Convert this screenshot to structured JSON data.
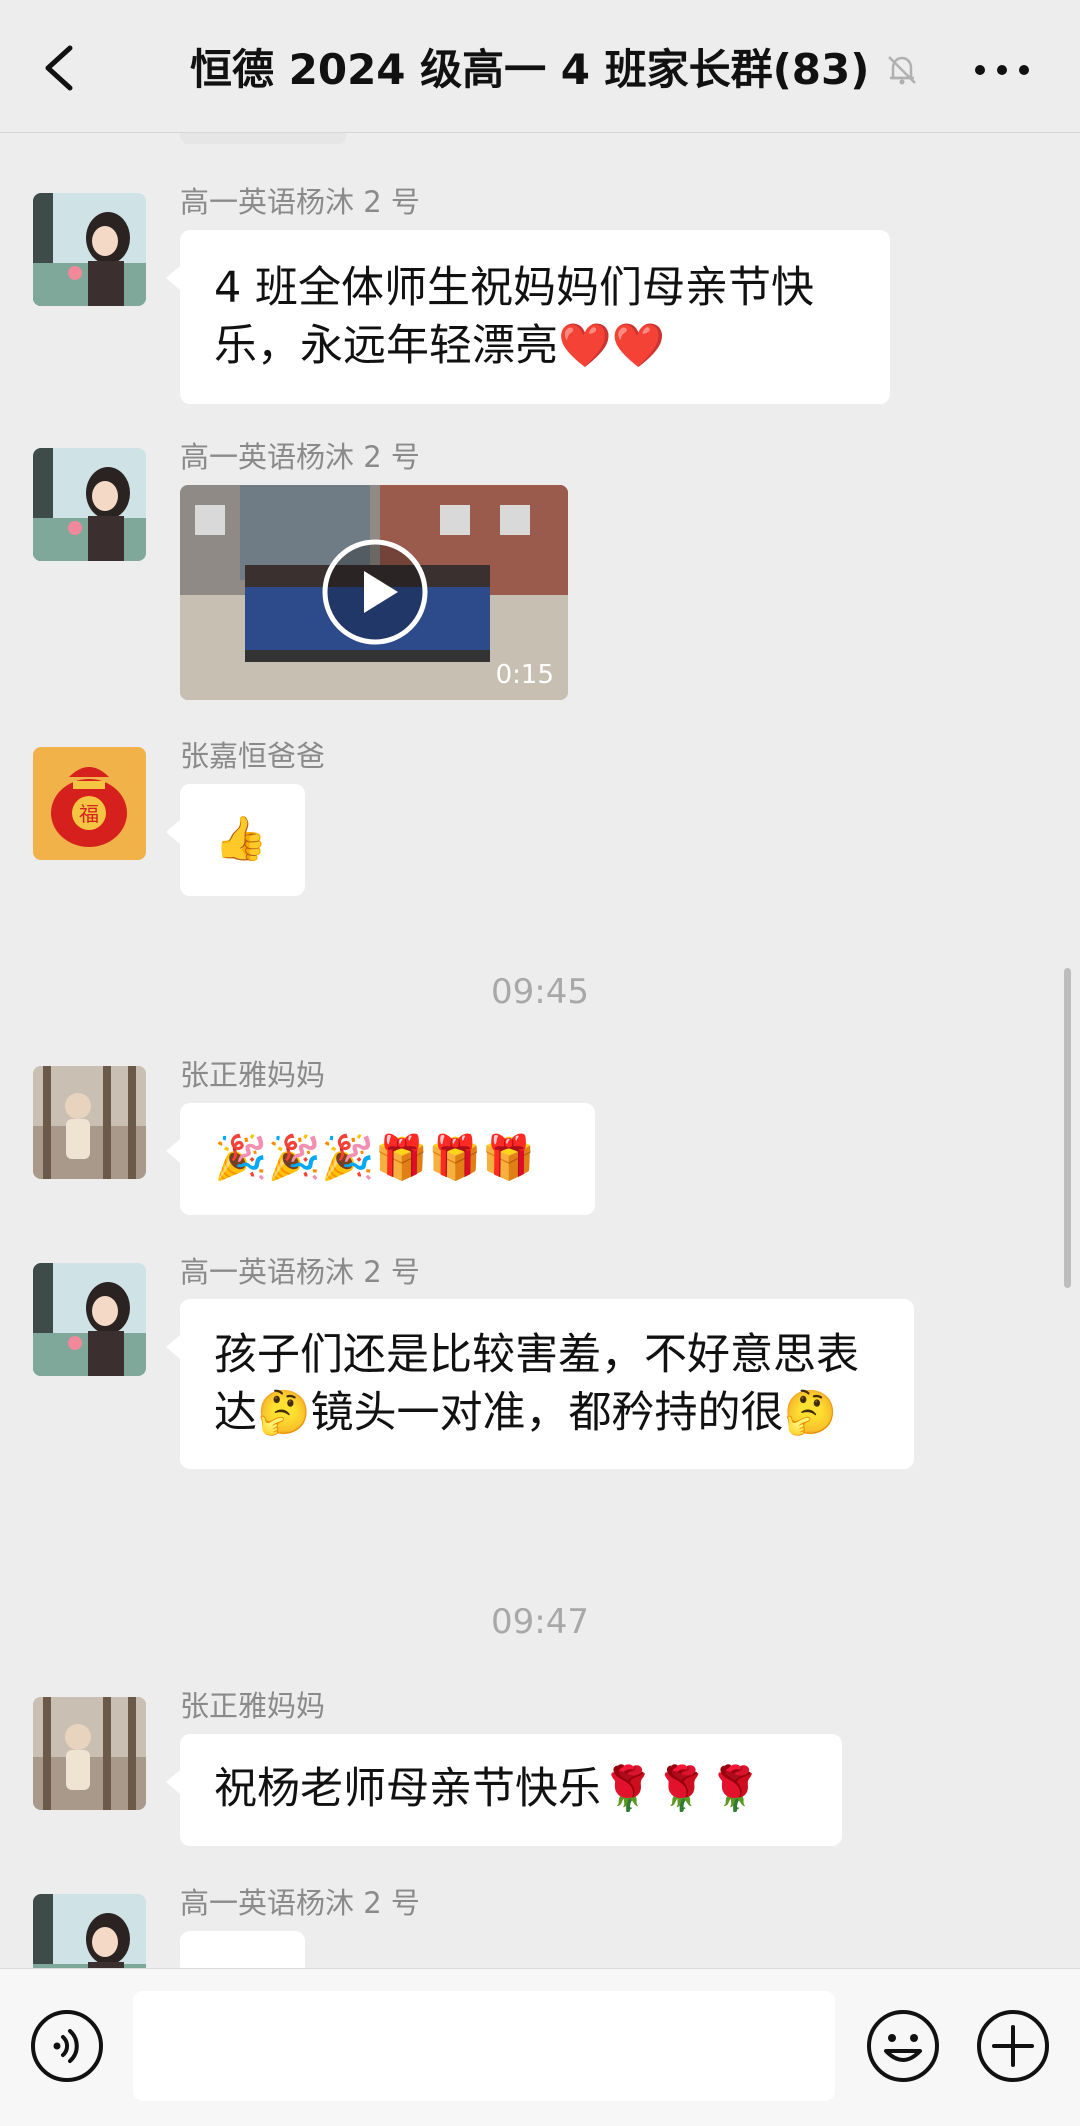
{
  "header": {
    "title": "恒德 2024 级高一 4 班家长群(83)",
    "back_icon": "chevron-left-icon",
    "mute_icon": "bell-slash-icon",
    "more_icon": "more-dots-icon"
  },
  "messages": [
    {
      "sender": "高一英语杨沐 2 号",
      "text": "4 班全体师生祝妈妈们母亲节快乐，永远年轻漂亮❤️❤️"
    },
    {
      "sender": "高一英语杨沐 2 号",
      "video_duration": "0:15"
    },
    {
      "sender": "张嘉恒爸爸",
      "text": "👍"
    },
    {
      "time": "09:45"
    },
    {
      "sender": "张正雅妈妈",
      "text": "🎉🎉🎉🎁🎁🎁"
    },
    {
      "sender": "高一英语杨沐 2 号",
      "text": "孩子们还是比较害羞，不好意思表达🤔镜头一对准，都矜持的很🤔"
    },
    {
      "time": "09:47"
    },
    {
      "sender": "张正雅妈妈",
      "text": "祝杨老师母亲节快乐🌹🌹🌹"
    },
    {
      "sender": "高一英语杨沐 2 号"
    }
  ],
  "input_bar": {
    "value": "",
    "voice_icon": "voice-icon",
    "emoji_icon": "smiley-icon",
    "plus_icon": "plus-circle-icon"
  },
  "colors": {
    "background": "#ededed",
    "bubble": "#ffffff",
    "name": "#8a8a8a",
    "time": "#a8a8a8"
  }
}
